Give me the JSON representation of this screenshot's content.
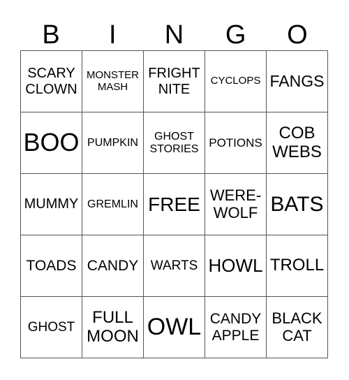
{
  "header": [
    "B",
    "I",
    "N",
    "G",
    "O"
  ],
  "rows": [
    [
      "SCARY\nCLOWN",
      "MONSTER\nMASH",
      "FRIGHT\nNITE",
      "CYCLOPS",
      "FANGS"
    ],
    [
      "BOO",
      "PUMPKIN",
      "GHOST\nSTORIES",
      "POTIONS",
      "COB\nWEBS"
    ],
    [
      "MUMMY",
      "GREMLIN",
      "FREE",
      "WERE-\nWOLF",
      "BATS"
    ],
    [
      "TOADS",
      "CANDY",
      "WARTS",
      "HOWL",
      "TROLL"
    ],
    [
      "GHOST",
      "FULL\nMOON",
      "OWL",
      "CANDY\nAPPLE",
      "BLACK\nCAT"
    ]
  ]
}
